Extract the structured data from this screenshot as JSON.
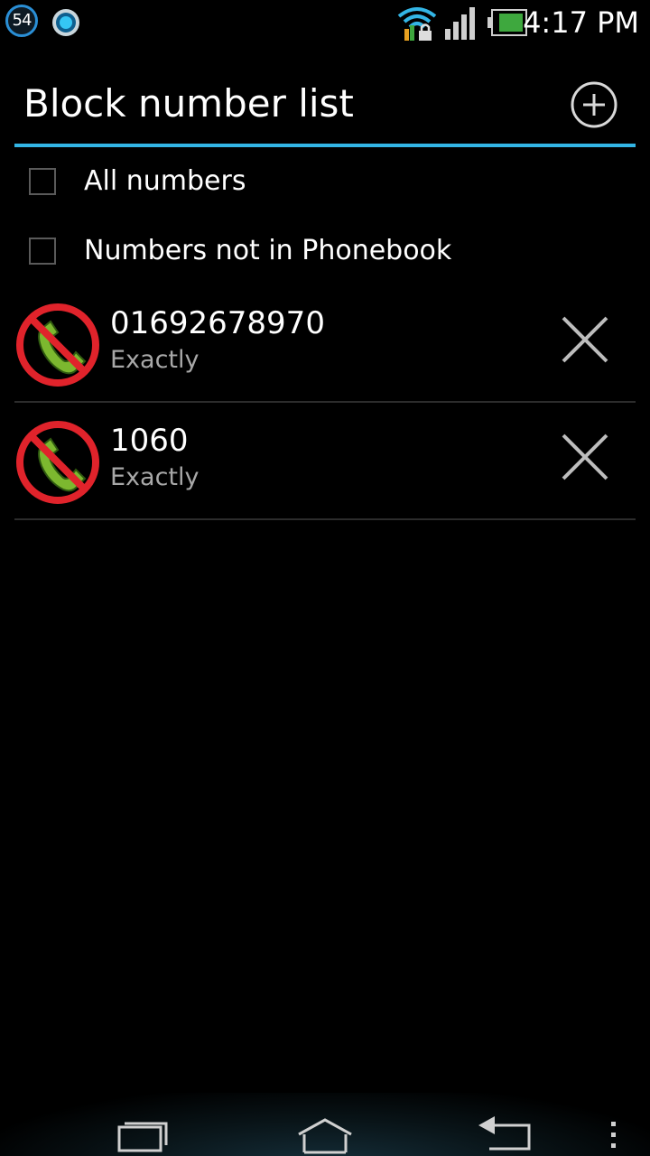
{
  "status_bar": {
    "badge_number": "54",
    "time": "4:17 PM",
    "icons": [
      "notification-badge-icon",
      "blue-dot-icon",
      "wifi-icon",
      "lock-icon",
      "signal-icon",
      "battery-icon"
    ]
  },
  "header": {
    "title": "Block number list",
    "add_icon": "add-circle-icon"
  },
  "options": [
    {
      "label": "All numbers",
      "checked": false
    },
    {
      "label": "Numbers not in Phonebook",
      "checked": false
    }
  ],
  "blocked": [
    {
      "number": "01692678970",
      "match": "Exactly"
    },
    {
      "number": "1060",
      "match": "Exactly"
    }
  ],
  "navigation": {
    "icons": [
      "recent-apps-icon",
      "home-icon",
      "back-icon",
      "menu-dots-icon"
    ]
  },
  "colors": {
    "accent": "#33b5e5",
    "background": "#000000",
    "block_red": "#e0232b",
    "phone_green": "#7cb82f",
    "secondary_text": "#a8a8a8"
  }
}
